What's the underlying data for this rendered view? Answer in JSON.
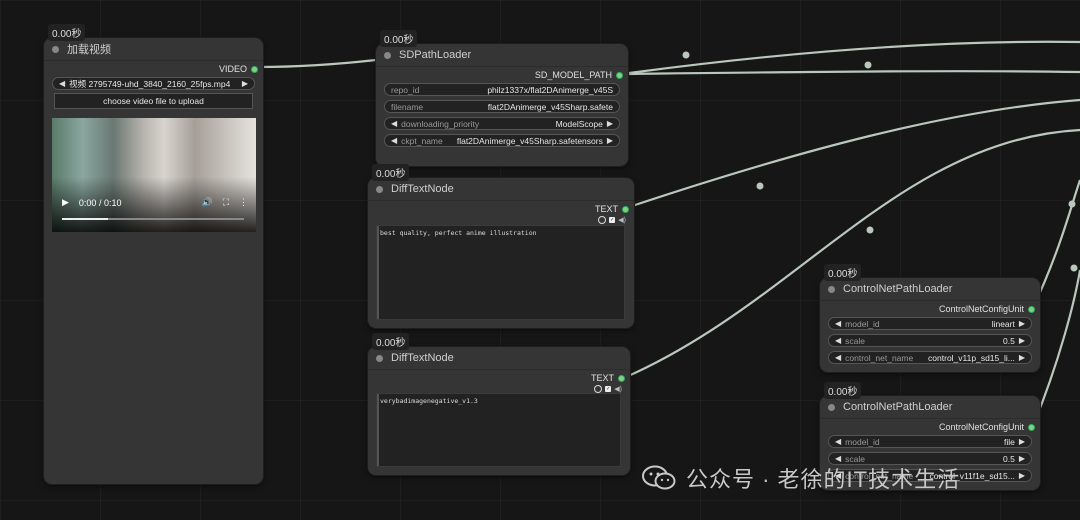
{
  "nodes": {
    "video_loader": {
      "badge": "0.00秒",
      "title": "加载视频",
      "output": "VIDEO",
      "video_label": "视频",
      "video_value": "2795749-uhd_3840_2160_25fps.mp4",
      "upload_button": "choose video file to upload",
      "player_time": "0:00 / 0:10",
      "progress": 0.25
    },
    "sd_path_loader": {
      "badge": "0.00秒",
      "title": "SDPathLoader",
      "output": "SD_MODEL_PATH",
      "widgets": [
        {
          "label": "repo_id",
          "value": "philz1337x/flat2DAnimerge_v45S"
        },
        {
          "label": "filename",
          "value": "flat2DAnimerge_v45Sharp.safete"
        },
        {
          "label": "downloading_priority",
          "value": "ModelScope"
        },
        {
          "label": "ckpt_name",
          "value": "flat2DAnimerge_v45Sharp.safetensors"
        }
      ]
    },
    "diff_text_1": {
      "badge": "0.00秒",
      "title": "DiffTextNode",
      "output": "TEXT",
      "text": "best quality, perfect anime illustration"
    },
    "diff_text_2": {
      "badge": "0.00秒",
      "title": "DiffTextNode",
      "output": "TEXT",
      "text": "verybadimagenegative_v1.3"
    },
    "controlnet_1": {
      "badge": "0.00秒",
      "title": "ControlNetPathLoader",
      "output": "ControlNetConfigUnit",
      "widgets": [
        {
          "label": "model_id",
          "value": "lineart"
        },
        {
          "label": "scale",
          "value": "0.5"
        },
        {
          "label": "control_net_name",
          "value": "control_v11p_sd15_li..."
        }
      ]
    },
    "controlnet_2": {
      "badge": "0.00秒",
      "title": "ControlNetPathLoader",
      "output": "ControlNetConfigUnit",
      "widgets": [
        {
          "label": "model_id",
          "value": "file"
        },
        {
          "label": "scale",
          "value": "0.5"
        },
        {
          "label": "control_net_name",
          "value": "control_v11f1e_sd15..."
        }
      ]
    }
  },
  "watermark": "公众号 · 老徐的IT技术生活",
  "colors": {
    "wire": "#b9c7bd",
    "pin": "#7fd37f",
    "node_bg": "#353535",
    "canvas_bg": "#161616"
  }
}
